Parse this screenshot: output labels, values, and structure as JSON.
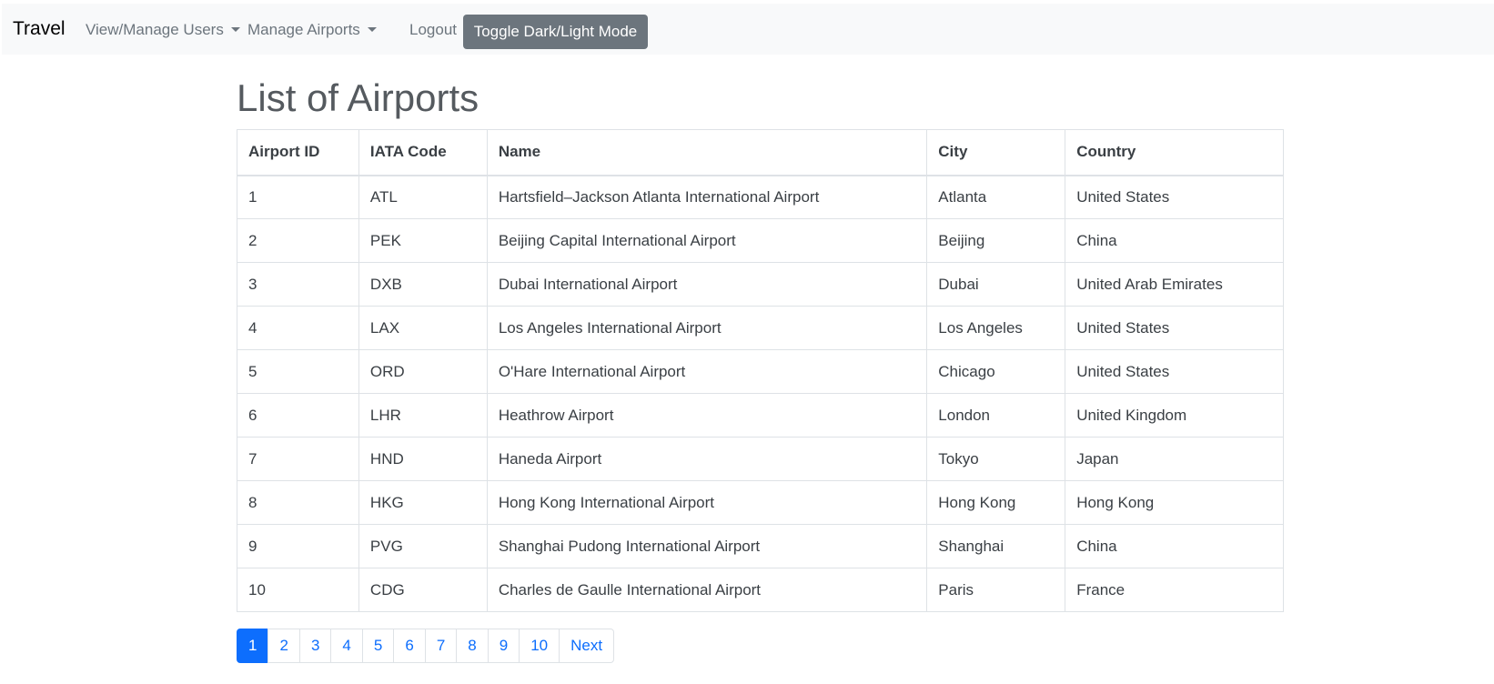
{
  "navbar": {
    "brand": "Travel",
    "items": [
      {
        "label": "View/Manage Users",
        "dropdown": true
      },
      {
        "label": "Manage Airports",
        "dropdown": true
      },
      {
        "label": "Logout",
        "dropdown": false
      }
    ],
    "toggle_label": "Toggle Dark/Light Mode"
  },
  "page": {
    "title": "List of Airports"
  },
  "table": {
    "headers": [
      "Airport ID",
      "IATA Code",
      "Name",
      "City",
      "Country"
    ],
    "rows": [
      [
        "1",
        "ATL",
        "Hartsfield–Jackson Atlanta International Airport",
        "Atlanta",
        "United States"
      ],
      [
        "2",
        "PEK",
        "Beijing Capital International Airport",
        "Beijing",
        "China"
      ],
      [
        "3",
        "DXB",
        "Dubai International Airport",
        "Dubai",
        "United Arab Emirates"
      ],
      [
        "4",
        "LAX",
        "Los Angeles International Airport",
        "Los Angeles",
        "United States"
      ],
      [
        "5",
        "ORD",
        "O'Hare International Airport",
        "Chicago",
        "United States"
      ],
      [
        "6",
        "LHR",
        "Heathrow Airport",
        "London",
        "United Kingdom"
      ],
      [
        "7",
        "HND",
        "Haneda Airport",
        "Tokyo",
        "Japan"
      ],
      [
        "8",
        "HKG",
        "Hong Kong International Airport",
        "Hong Kong",
        "Hong Kong"
      ],
      [
        "9",
        "PVG",
        "Shanghai Pudong International Airport",
        "Shanghai",
        "China"
      ],
      [
        "10",
        "CDG",
        "Charles de Gaulle International Airport",
        "Paris",
        "France"
      ]
    ]
  },
  "pagination": {
    "pages": [
      "1",
      "2",
      "3",
      "4",
      "5",
      "6",
      "7",
      "8",
      "9",
      "10"
    ],
    "active": "1",
    "next_label": "Next"
  },
  "colors": {
    "active_page": "#0d6efd",
    "toggle_button": "#6c757d",
    "navbar_bg": "#f8f9fa"
  }
}
